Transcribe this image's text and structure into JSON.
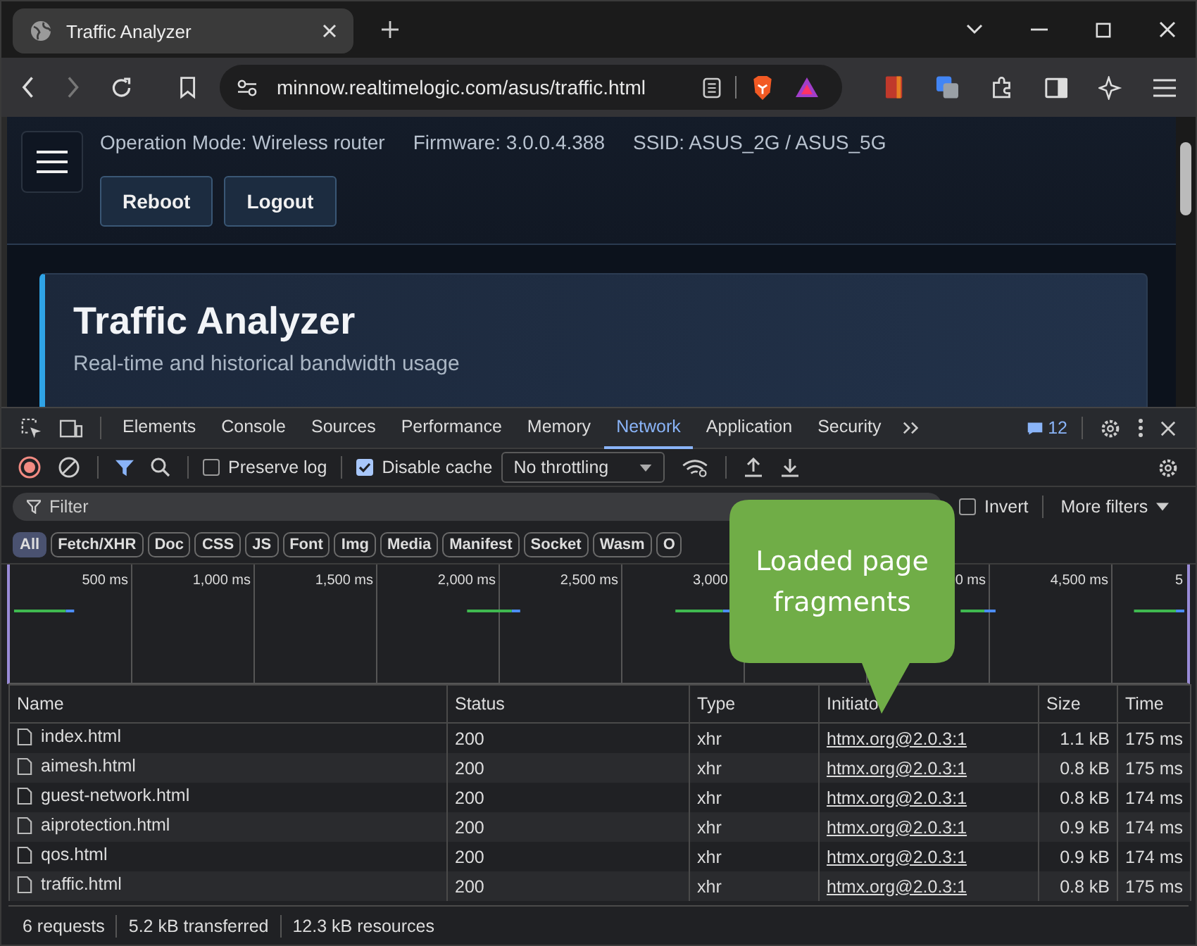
{
  "browser": {
    "tab_title": "Traffic Analyzer",
    "url": "minnow.realtimelogic.com/asus/traffic.html"
  },
  "page": {
    "info": [
      "Operation Mode: Wireless router",
      "Firmware: 3.0.0.4.388",
      "SSID: ASUS_2G / ASUS_5G"
    ],
    "buttons": [
      "Reboot",
      "Logout"
    ],
    "card_title": "Traffic Analyzer",
    "card_subtitle": "Real-time and historical bandwidth usage"
  },
  "devtools": {
    "tabs": [
      {
        "label": "Elements",
        "selected": false
      },
      {
        "label": "Console",
        "selected": false
      },
      {
        "label": "Sources",
        "selected": false
      },
      {
        "label": "Performance",
        "selected": false
      },
      {
        "label": "Memory",
        "selected": false
      },
      {
        "label": "Network",
        "selected": true
      },
      {
        "label": "Application",
        "selected": false
      },
      {
        "label": "Security",
        "selected": false
      }
    ],
    "message_count": "12",
    "toolbar": {
      "preserve_log": {
        "label": "Preserve log",
        "checked": false
      },
      "disable_cache": {
        "label": "Disable cache",
        "checked": true
      },
      "throttling": "No throttling"
    },
    "filter": {
      "placeholder": "Filter",
      "invert": {
        "label": "Invert",
        "checked": false
      },
      "more_filters": "More filters"
    },
    "type_filters": [
      {
        "label": "All",
        "selected": true
      },
      {
        "label": "Fetch/XHR",
        "selected": false
      },
      {
        "label": "Doc",
        "selected": false
      },
      {
        "label": "CSS",
        "selected": false
      },
      {
        "label": "JS",
        "selected": false
      },
      {
        "label": "Font",
        "selected": false
      },
      {
        "label": "Img",
        "selected": false
      },
      {
        "label": "Media",
        "selected": false
      },
      {
        "label": "Manifest",
        "selected": false
      },
      {
        "label": "Socket",
        "selected": false
      },
      {
        "label": "Wasm",
        "selected": false
      },
      {
        "label": "O",
        "selected": false
      }
    ],
    "overview_ticks": [
      "500 ms",
      "1,000 ms",
      "1,500 ms",
      "2,000 ms",
      "2,500 ms",
      "3,000",
      "0 ms",
      "4,500 ms",
      "5"
    ],
    "table": {
      "columns": [
        "Name",
        "Status",
        "Type",
        "Initiato",
        "Size",
        "Time"
      ],
      "rows": [
        {
          "name": "index.html",
          "status": "200",
          "type": "xhr",
          "initiator": "htmx.org@2.0.3:1",
          "size": "1.1 kB",
          "time": "175 ms"
        },
        {
          "name": "aimesh.html",
          "status": "200",
          "type": "xhr",
          "initiator": "htmx.org@2.0.3:1",
          "size": "0.8 kB",
          "time": "175 ms"
        },
        {
          "name": "guest-network.html",
          "status": "200",
          "type": "xhr",
          "initiator": "htmx.org@2.0.3:1",
          "size": "0.8 kB",
          "time": "174 ms"
        },
        {
          "name": "aiprotection.html",
          "status": "200",
          "type": "xhr",
          "initiator": "htmx.org@2.0.3:1",
          "size": "0.9 kB",
          "time": "174 ms"
        },
        {
          "name": "qos.html",
          "status": "200",
          "type": "xhr",
          "initiator": "htmx.org@2.0.3:1",
          "size": "0.9 kB",
          "time": "174 ms"
        },
        {
          "name": "traffic.html",
          "status": "200",
          "type": "xhr",
          "initiator": "htmx.org@2.0.3:1",
          "size": "0.8 kB",
          "time": "175 ms"
        }
      ]
    },
    "status_bar": [
      "6 requests",
      "5.2 kB transferred",
      "12.3 kB resources"
    ]
  },
  "callout": {
    "text": "Loaded page fragments"
  }
}
